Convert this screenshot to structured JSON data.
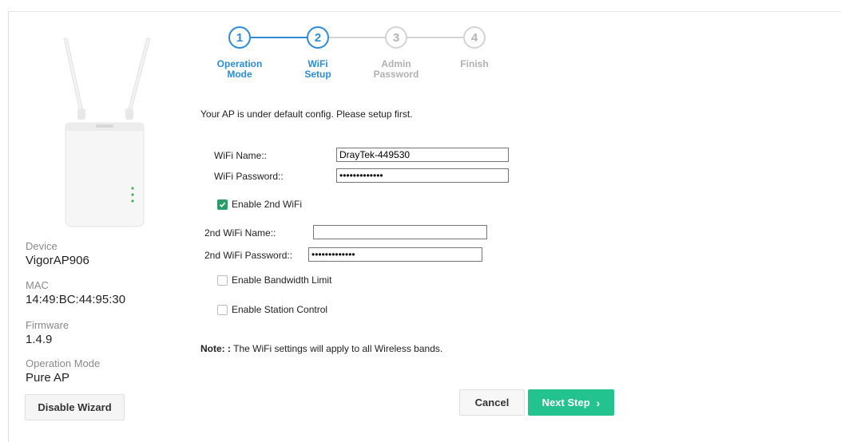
{
  "stepper": {
    "steps": [
      {
        "number": "1",
        "label_line1": "Operation",
        "label_line2": "Mode",
        "state": "active"
      },
      {
        "number": "2",
        "label_line1": "WiFi",
        "label_line2": "Setup",
        "state": "active"
      },
      {
        "number": "3",
        "label_line1": "Admin",
        "label_line2": "Password",
        "state": "inactive"
      },
      {
        "number": "4",
        "label_line1": "Finish",
        "label_line2": "",
        "state": "inactive"
      }
    ]
  },
  "device_info": {
    "device_label": "Device",
    "device_value": "VigorAP906",
    "mac_label": "MAC",
    "mac_value": "14:49:BC:44:95:30",
    "firmware_label": "Firmware",
    "firmware_value": "1.4.9",
    "mode_label": "Operation Mode",
    "mode_value": "Pure AP"
  },
  "buttons": {
    "disable_wizard": "Disable Wizard",
    "cancel": "Cancel",
    "next_step": "Next Step"
  },
  "form": {
    "intro": "Your AP is under default config. Please setup first.",
    "wifi_name_label": "WiFi Name::",
    "wifi_name_value": "DrayTek-449530",
    "wifi_password_label": "WiFi Password::",
    "wifi_password_value": "•••••••••••••",
    "enable_2nd_wifi": "Enable 2nd WiFi",
    "enable_2nd_wifi_checked": true,
    "wifi2_name_label": "2nd WiFi Name::",
    "wifi2_name_value": "",
    "wifi2_password_label": "2nd WiFi Password::",
    "wifi2_password_value": "•••••••••••••",
    "bandwidth_limit": "Enable Bandwidth Limit",
    "bandwidth_limit_checked": false,
    "station_control": "Enable Station Control",
    "station_control_checked": false
  },
  "note": {
    "prefix": "Note: :",
    "text": " The WiFi settings will apply to all Wireless bands."
  },
  "colors": {
    "accent_blue": "#2e8bd8",
    "next_green": "#22c38e",
    "check_green": "#2e9b6b",
    "inactive_gray": "#d4d4d4"
  }
}
